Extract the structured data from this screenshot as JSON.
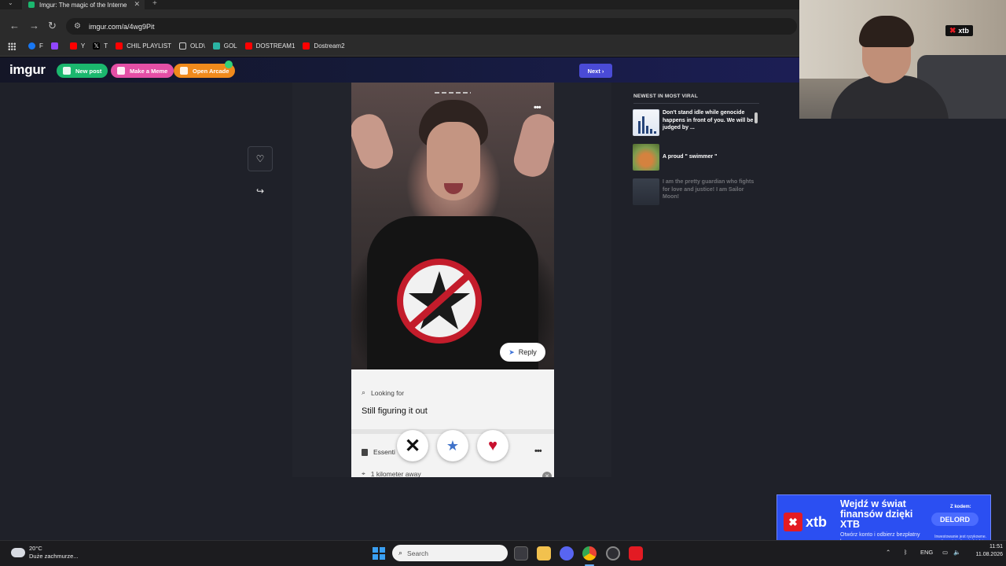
{
  "browser": {
    "tab_title": "Imgur: The magic of the Interne",
    "tab_close": "✕",
    "new_tab": "+",
    "url": "imgur.com/a/4wg9Pit",
    "bookmarks": [
      {
        "label": "F",
        "color": "#1877f2"
      },
      {
        "label": "",
        "color": "#9146ff"
      },
      {
        "label": "Y",
        "color": "#ff0000"
      },
      {
        "label": "T",
        "color": "#000000"
      },
      {
        "label": "CHIL PLAYLIST",
        "color": "#ff0000"
      },
      {
        "label": "OLD\\",
        "color": "folder"
      },
      {
        "label": "GOL",
        "color": "#2bb3a3"
      },
      {
        "label": "DOSTREAM1",
        "color": "#ff0000"
      },
      {
        "label": "Dostream2",
        "color": "#ff0000"
      }
    ]
  },
  "imgur": {
    "logo": "imgur",
    "new_post": "New post",
    "make_meme": "Make a Meme",
    "open_arcade": "Open Arcade",
    "next": "Next",
    "colors": {
      "new_post": "#1bb76e",
      "make_meme": "#e44fa6",
      "open_arcade": "#f08a1c",
      "next": "#4a4bd6"
    }
  },
  "post": {
    "reply": "Reply",
    "looking_for_label": "Looking for",
    "looking_for_value": "Still figuring it out",
    "essentials_label": "Essenti",
    "distance": "1 kilometer away"
  },
  "sidebar": {
    "heading": "NEWEST IN MOST VIRAL",
    "items": [
      {
        "title": "Don't stand idle while genocide happens in front of you. We will be judged by ..."
      },
      {
        "title": "A proud \" swimmer \""
      },
      {
        "title": "I am the pretty guardian who fights for love and justice! I am Sailor Moon!"
      }
    ]
  },
  "overlay": {
    "webcam_brand": "xtb",
    "ad": {
      "brand": "xtb",
      "headline": "Wejdź w świat finansów dzięki XTB",
      "sub": "Otwórz konto i odbierz bezpłatny kurs",
      "code_label": "Z kodem:",
      "code": "DELORD",
      "disclaimer": "Inwestowanie jest ryzykowne. Inwestuj odpowiedzialnie."
    }
  },
  "taskbar": {
    "temp": "20°C",
    "weather": "Duże zachmurze...",
    "search": "Search",
    "lang": "ENG",
    "time": "11:51",
    "date": "11.08.2026"
  }
}
